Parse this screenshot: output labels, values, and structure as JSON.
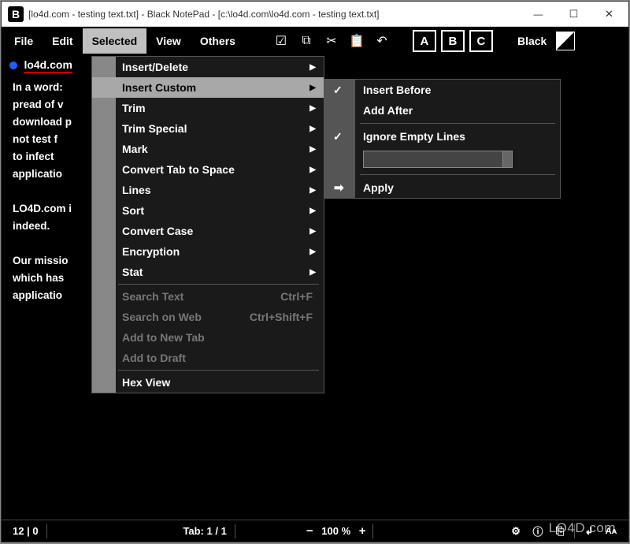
{
  "window": {
    "title": "[lo4d.com - testing text.txt] - Black NotePad - [c:\\lo4d.com\\lo4d.com - testing text.txt]"
  },
  "menubar": {
    "file": "File",
    "edit": "Edit",
    "selected": "Selected",
    "view": "View",
    "others": "Others",
    "keyA": "A",
    "keyB": "B",
    "keyC": "C",
    "theme": "Black"
  },
  "tab": {
    "name": "lo4d.com"
  },
  "editor_text": "In a word:\npread of v\ndownload p\nnot test f\nto infect \napplicatio\n\nLO4D.com i                         y mean Internet\nindeed.\n\nOur missio                         igh quality software\nwhich has                          st antivirus\napplicatio",
  "dropdown": {
    "items": [
      {
        "label": "Insert/Delete",
        "arrow": true
      },
      {
        "label": "Insert Custom",
        "arrow": true,
        "highlighted": true
      },
      {
        "label": "Trim",
        "arrow": true
      },
      {
        "label": "Trim Special",
        "arrow": true
      },
      {
        "label": "Mark",
        "arrow": true
      },
      {
        "label": "Convert Tab to Space",
        "arrow": true
      },
      {
        "label": "Lines",
        "arrow": true
      },
      {
        "label": "Sort",
        "arrow": true
      },
      {
        "label": "Convert Case",
        "arrow": true
      },
      {
        "label": "Encryption",
        "arrow": true
      },
      {
        "label": "Stat",
        "arrow": true
      }
    ],
    "sep": true,
    "disabled_items": [
      {
        "label": "Search Text",
        "shortcut": "Ctrl+F"
      },
      {
        "label": "Search on Web",
        "shortcut": "Ctrl+Shift+F"
      },
      {
        "label": "Add to New Tab"
      },
      {
        "label": "Add to Draft"
      }
    ],
    "final": [
      {
        "label": "Hex View"
      }
    ]
  },
  "submenu": {
    "items": [
      {
        "label": "Insert Before",
        "checked": true
      },
      {
        "label": "Add After",
        "checked": false
      }
    ],
    "ignore": {
      "label": "Ignore Empty Lines",
      "checked": true
    },
    "input_value": "",
    "apply": "Apply"
  },
  "statusbar": {
    "cursor": "12 | 0",
    "tab": "Tab: 1 / 1",
    "zoom": "100 %"
  },
  "watermark": "LO4D.com"
}
